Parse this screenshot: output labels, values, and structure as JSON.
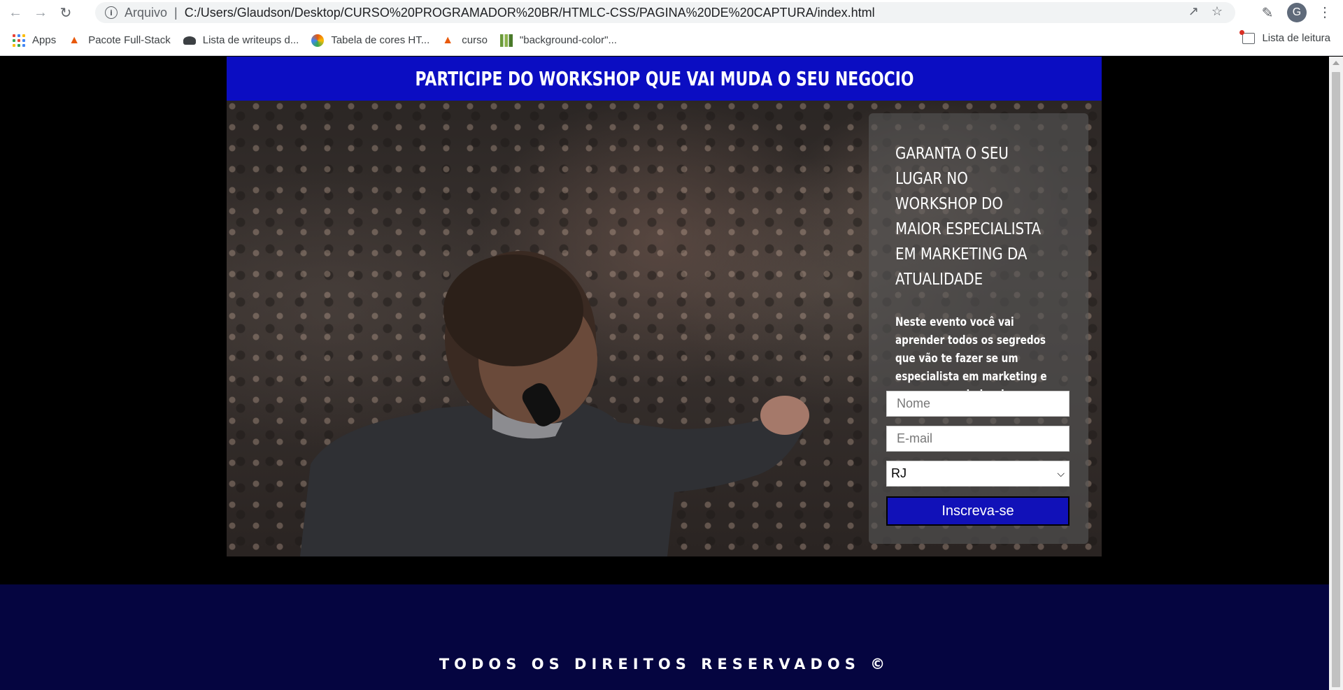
{
  "browser": {
    "back_icon": "arrow-left-icon",
    "forward_icon": "arrow-right-icon",
    "reload_icon": "reload-icon",
    "security_label": "Arquivo",
    "url": "C:/Users/Glaudson/Desktop/CURSO%20PROGRAMADOR%20BR/HTMLC-CSS/PAGINA%20DE%20CAPTURA/index.html",
    "avatar_letter": "G"
  },
  "bookmarks": {
    "items": [
      {
        "label": "Apps"
      },
      {
        "label": "Pacote Full-Stack"
      },
      {
        "label": "Lista de writeups d..."
      },
      {
        "label": "Tabela de cores HT..."
      },
      {
        "label": "curso"
      },
      {
        "label": "\"background-color\"..."
      }
    ],
    "reading_list": "Lista de leitura"
  },
  "page": {
    "banner_title": "PARTICIPE DO WORKSHOP QUE VAI MUDA O SEU NEGOCIO",
    "form": {
      "title": "GARANTA O SEU LUGAR NO WORKSHOP DO MAIOR ESPECIALISTA EM MARKETING DA ATUALIDADE",
      "description": "Neste evento você vai aprender todos os segredos que vão te fazer se um especialista em marketing e um empreendedor de sucesso.",
      "name_placeholder": "Nome",
      "email_placeholder": "E-mail",
      "state_selected": "RJ",
      "submit_label": "Inscreva-se"
    },
    "footer_text": "TODOS OS DIREITOS RESERVADOS ©"
  },
  "colors": {
    "banner": "#0b0dc2",
    "submit": "#1111b8",
    "footer": "#050540"
  }
}
